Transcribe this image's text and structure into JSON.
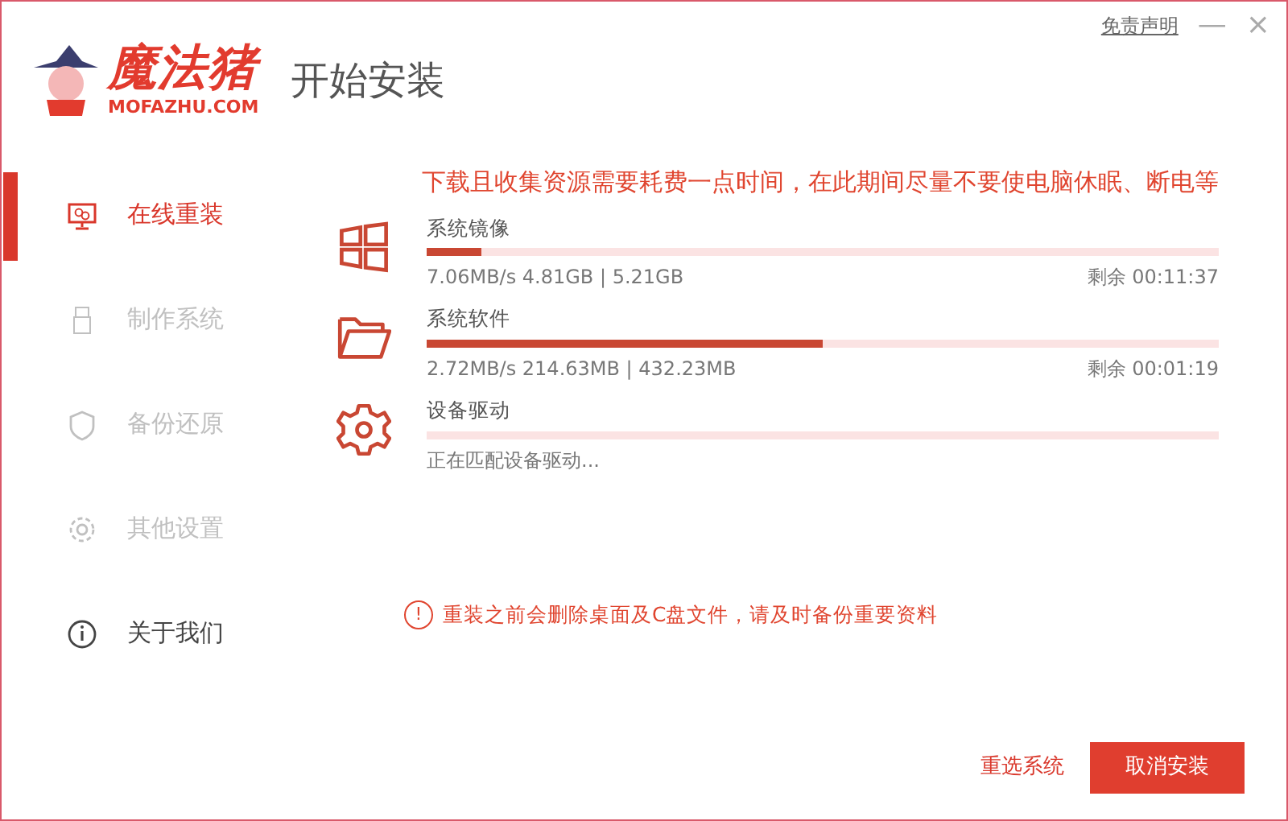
{
  "window": {
    "logo_name": "魔法猪",
    "logo_site": "MOFAZHU.COM",
    "title": "开始安装",
    "disclaimer_link": "免责声明",
    "minimize": "—",
    "close": "×"
  },
  "sidebar": {
    "items": [
      {
        "label": "在线重装",
        "selected": true,
        "disabled": false
      },
      {
        "label": "制作系统",
        "selected": false,
        "disabled": true
      },
      {
        "label": "备份还原",
        "selected": false,
        "disabled": true
      },
      {
        "label": "其他设置",
        "selected": false,
        "disabled": true
      },
      {
        "label": "关于我们",
        "selected": false,
        "disabled": false
      }
    ]
  },
  "notice": "下载且收集资源需要耗费一点时间，在此期间尽量不要使电脑休眠、断电等",
  "tasks": [
    {
      "name": "系统镜像",
      "level": 0.07,
      "detail": "7.06MB/s 4.81GB | 5.21GB",
      "remaining": "剩余 00:11:37"
    },
    {
      "name": "系统软件",
      "level": 0.5,
      "detail": "2.72MB/s 214.63MB | 432.23MB",
      "remaining": "剩余 00:01:19"
    },
    {
      "name": "设备驱动",
      "level": 0,
      "detail": "正在匹配设备驱动..."
    }
  ],
  "warning": {
    "icon": "!",
    "text": "重装之前会删除桌面及C盘文件，请及时备份重要资料"
  },
  "buttons": {
    "reselect": "重选系统",
    "cancel": "取消安装"
  }
}
